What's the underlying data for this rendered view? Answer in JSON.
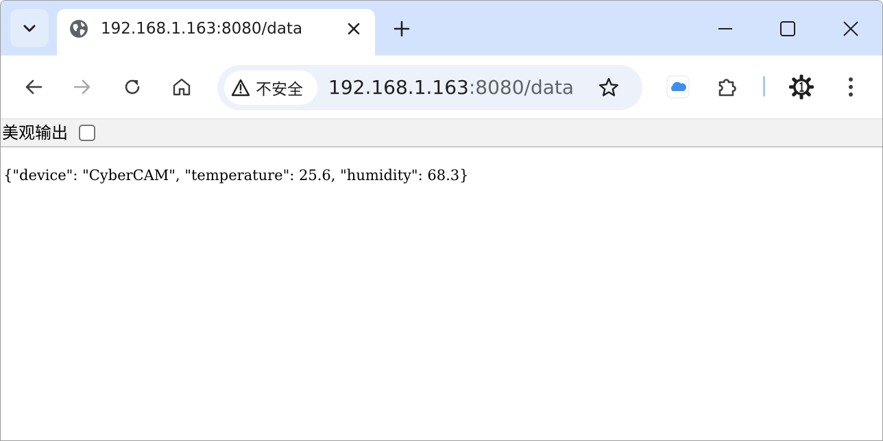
{
  "tab": {
    "title": "192.168.1.163:8080/data"
  },
  "omnibox": {
    "security_label": "不安全",
    "url_host": "192.168.1.163",
    "url_rest": ":8080/data"
  },
  "pretty_print": {
    "label": "美观输出",
    "checked": false
  },
  "content": {
    "json_text": "{\"device\": \"CyberCAM\", \"temperature\": 25.6, \"humidity\": 68.3}"
  },
  "icons": {
    "tab_search": "chevron-down-icon",
    "tab_favicon": "globe-icon",
    "tab_close": "close-icon",
    "new_tab": "plus-icon",
    "minimize": "minimize-icon",
    "maximize": "maximize-icon",
    "close_window": "close-icon",
    "back": "arrow-left-icon",
    "forward": "arrow-right-icon",
    "reload": "reload-icon",
    "home": "home-icon",
    "security": "warning-triangle-icon",
    "bookmark": "star-icon",
    "icloud_extension": "cloud-icon",
    "extensions": "puzzle-icon",
    "settings_extension": "gear-icon",
    "menu": "more-vertical-icon"
  },
  "colors": {
    "tabstrip_bg": "#d3e3fd",
    "omnibox_bg": "#edf2fa",
    "icloud_blue": "#3d8ef0"
  }
}
